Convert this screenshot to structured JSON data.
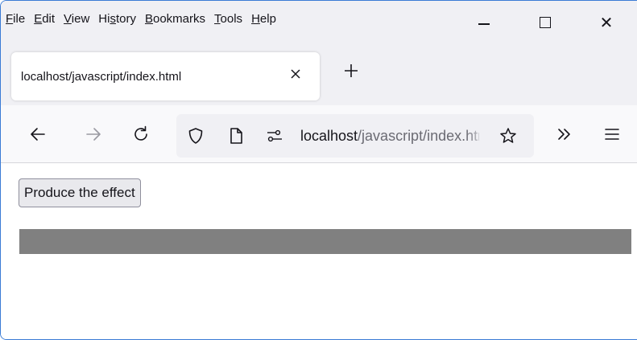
{
  "menu": {
    "items": [
      {
        "accel": "F",
        "rest": "ile"
      },
      {
        "accel": "E",
        "rest": "dit"
      },
      {
        "accel": "V",
        "rest": "iew"
      },
      {
        "pre": "Hi",
        "accel": "s",
        "rest": "tory"
      },
      {
        "accel": "B",
        "rest": "ookmarks"
      },
      {
        "accel": "T",
        "rest": "ools"
      },
      {
        "accel": "H",
        "rest": "elp"
      }
    ]
  },
  "window_controls": {
    "close_glyph": "✕"
  },
  "tab": {
    "title": "localhost/javascript/index.html"
  },
  "urlbar": {
    "host": "localhost",
    "path": "/javascript/index.html"
  },
  "content": {
    "button_label": "Produce the effect",
    "bar_text": "",
    "bar_color": "#808080"
  },
  "icons": [
    "back-arrow-icon",
    "forward-arrow-icon",
    "reload-icon",
    "shield-icon",
    "page-icon",
    "permissions-icon",
    "star-icon",
    "overflow-chevrons-icon",
    "hamburger-menu-icon",
    "close-icon",
    "plus-icon"
  ]
}
